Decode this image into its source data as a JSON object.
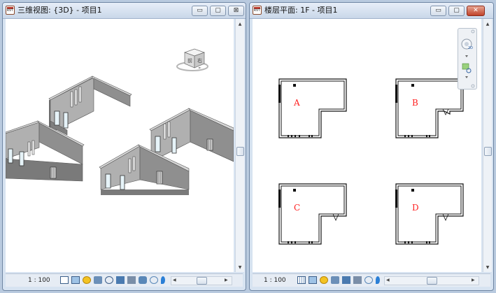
{
  "colors": {
    "title_active": "#c9d7e9",
    "close_red": "#c0432b",
    "room_label": "#ff2020",
    "wall_face": "#9a9a9a",
    "wall_top": "#d8d8d8"
  },
  "app_icon_text": "RVT",
  "left_window": {
    "title": "三维视图: {3D} - 项目1",
    "controls": {
      "minimize": "▭",
      "maximize": "▢",
      "close": "⊠"
    },
    "viewcube": {
      "face_label": "前",
      "side_label": "右"
    },
    "status": {
      "scale": "1 : 100"
    }
  },
  "right_window": {
    "title": "楼层平面: 1F - 项目1",
    "controls": {
      "minimize": "▭",
      "maximize": "▢",
      "close": "✕"
    },
    "rooms": [
      {
        "label": "A"
      },
      {
        "label": "B"
      },
      {
        "label": "C"
      },
      {
        "label": "D"
      }
    ],
    "status": {
      "scale": "1 : 100"
    }
  }
}
